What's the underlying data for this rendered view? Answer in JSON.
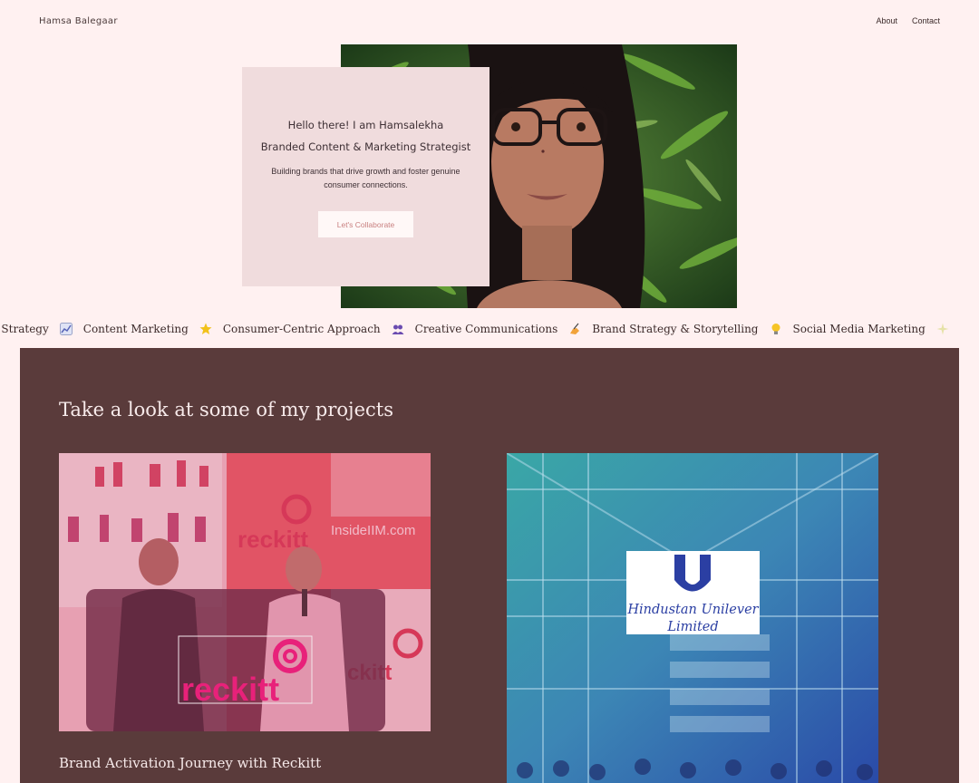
{
  "header": {
    "brand": "Hamsa Balegaar",
    "nav": [
      {
        "label": "About"
      },
      {
        "label": "Contact"
      }
    ]
  },
  "hero": {
    "greeting": "Hello there! I am Hamsalekha",
    "role": "Branded Content & Marketing Strategist",
    "tagline": "Building brands that drive growth and foster genuine consumer connections.",
    "cta_label": "Let's Collaborate"
  },
  "marquee": {
    "items": [
      {
        "label": "Marketing Strategy",
        "icon": "chart-icon"
      },
      {
        "label": "Content Marketing",
        "icon": "star-icon"
      },
      {
        "label": "Consumer-Centric Approach",
        "icon": "people-icon"
      },
      {
        "label": "Creative Communications",
        "icon": "writing-hand-icon"
      },
      {
        "label": "Brand Strategy & Storytelling",
        "icon": "lightbulb-icon"
      },
      {
        "label": "Social Media Marketing",
        "icon": "sparkle-icon"
      }
    ]
  },
  "projects": {
    "title": "Take a look at some of my projects",
    "items": [
      {
        "caption": "Brand Activation Journey with Reckitt",
        "logo_text": "reckitt",
        "banner_text": "InsideIIM.com"
      },
      {
        "caption": "",
        "logo_text_line1": "Hindustan Unilever",
        "logo_text_line2": "Limited"
      }
    ]
  },
  "colors": {
    "page_bg": "#fff1f1",
    "card_bg": "#f0dcdd",
    "projects_bg": "#5a3b3b",
    "accent": "#c98080"
  }
}
